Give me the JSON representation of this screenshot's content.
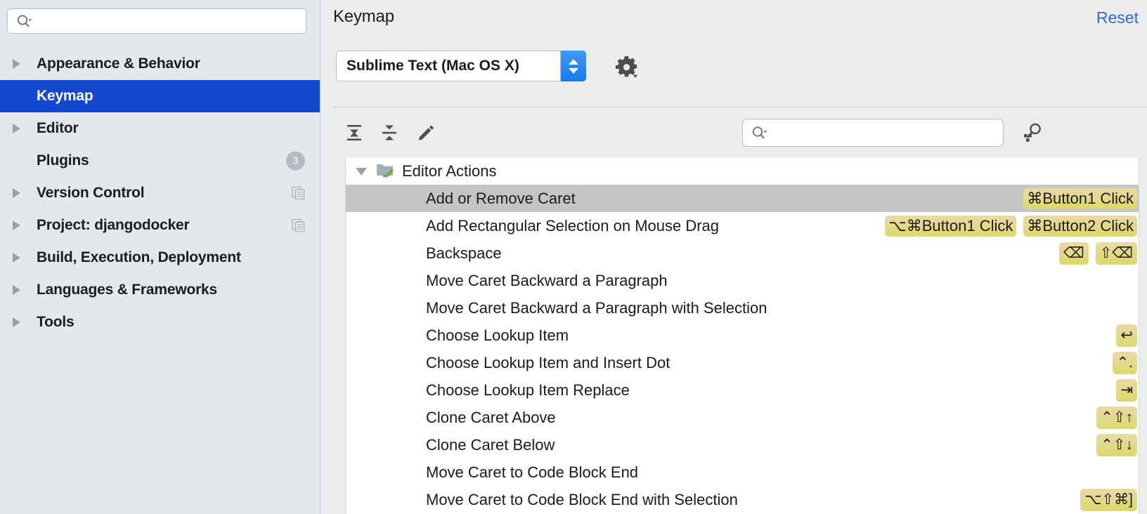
{
  "sidebar": {
    "search": {
      "placeholder": "",
      "value": "",
      "icon": "search-icon"
    },
    "items": [
      {
        "label": "Appearance & Behavior",
        "expandable": true,
        "selected": false,
        "badge": null,
        "copy_icon": false
      },
      {
        "label": "Keymap",
        "expandable": false,
        "selected": true,
        "badge": null,
        "copy_icon": false
      },
      {
        "label": "Editor",
        "expandable": true,
        "selected": false,
        "badge": null,
        "copy_icon": false
      },
      {
        "label": "Plugins",
        "expandable": false,
        "selected": false,
        "badge": "3",
        "copy_icon": false
      },
      {
        "label": "Version Control",
        "expandable": true,
        "selected": false,
        "badge": null,
        "copy_icon": true
      },
      {
        "label": "Project: djangodocker",
        "expandable": true,
        "selected": false,
        "badge": null,
        "copy_icon": true
      },
      {
        "label": "Build, Execution, Deployment",
        "expandable": true,
        "selected": false,
        "badge": null,
        "copy_icon": false
      },
      {
        "label": "Languages & Frameworks",
        "expandable": true,
        "selected": false,
        "badge": null,
        "copy_icon": false
      },
      {
        "label": "Tools",
        "expandable": true,
        "selected": false,
        "badge": null,
        "copy_icon": false
      }
    ]
  },
  "main": {
    "title": "Keymap",
    "reset_label": "Reset",
    "keymap_select": {
      "value": "Sublime Text (Mac OS X)",
      "stepper_icon": "stepper-up-down-icon"
    },
    "gear_icon": "gear-icon",
    "toolbar": {
      "expand_all_icon": "expand-all-icon",
      "collapse_all_icon": "collapse-all-icon",
      "edit_icon": "pencil-edit-icon",
      "find_shortcut_icon": "find-by-shortcut-icon",
      "filter": {
        "placeholder": "",
        "value": "",
        "icon": "search-icon"
      }
    },
    "accent_color": "#2f6bd6",
    "selection_color": "#1449cd",
    "row_selection_color": "#c5c5c5",
    "shortcut_badge_color": "#dcd96a"
  },
  "keymap_tree": {
    "group": {
      "label": "Editor Actions",
      "expanded": true,
      "icon": "editor-actions-folder-icon"
    },
    "rows": [
      {
        "action": "Add or Remove Caret",
        "selected": true,
        "shortcuts": [
          "⌘Button1 Click"
        ]
      },
      {
        "action": "Add Rectangular Selection on Mouse Drag",
        "selected": false,
        "shortcuts": [
          "⌥⌘Button1 Click",
          "⌘Button2 Click"
        ]
      },
      {
        "action": "Backspace",
        "selected": false,
        "shortcuts": [
          "⌫",
          "⇧⌫"
        ]
      },
      {
        "action": "Move Caret Backward a Paragraph",
        "selected": false,
        "shortcuts": []
      },
      {
        "action": "Move Caret Backward a Paragraph with Selection",
        "selected": false,
        "shortcuts": []
      },
      {
        "action": "Choose Lookup Item",
        "selected": false,
        "shortcuts": [
          "↩"
        ]
      },
      {
        "action": "Choose Lookup Item and Insert Dot",
        "selected": false,
        "shortcuts": [
          "⌃."
        ]
      },
      {
        "action": "Choose Lookup Item Replace",
        "selected": false,
        "shortcuts": [
          "⇥"
        ]
      },
      {
        "action": "Clone Caret Above",
        "selected": false,
        "shortcuts": [
          "⌃⇧↑"
        ]
      },
      {
        "action": "Clone Caret Below",
        "selected": false,
        "shortcuts": [
          "⌃⇧↓"
        ]
      },
      {
        "action": "Move Caret to Code Block End",
        "selected": false,
        "shortcuts": []
      },
      {
        "action": "Move Caret to Code Block End with Selection",
        "selected": false,
        "shortcuts": [
          "⌥⇧⌘]"
        ]
      }
    ]
  }
}
